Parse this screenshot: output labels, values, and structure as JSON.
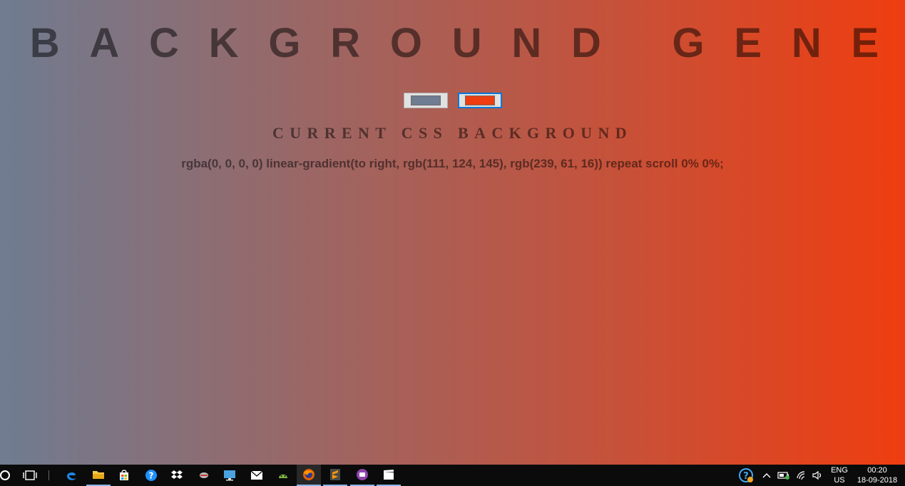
{
  "page": {
    "title": "BACKGROUND GENERATOR",
    "subtitle": "CURRENT CSS BACKGROUND",
    "css_output": "rgba(0, 0, 0, 0) linear-gradient(to right, rgb(111, 124, 145), rgb(239, 61, 16)) repeat scroll 0% 0%;",
    "color1": "#6f7c91",
    "color2": "#ef3d10"
  },
  "taskbar": {
    "icons": [
      {
        "name": "cortana-icon"
      },
      {
        "name": "task-view-icon"
      },
      {
        "name": "edge-icon"
      },
      {
        "name": "file-explorer-icon"
      },
      {
        "name": "store-icon"
      },
      {
        "name": "help-icon"
      },
      {
        "name": "dropbox-icon"
      },
      {
        "name": "app-icon"
      },
      {
        "name": "remote-desktop-icon"
      },
      {
        "name": "mail-icon"
      },
      {
        "name": "android-studio-icon"
      },
      {
        "name": "firefox-icon"
      },
      {
        "name": "sublime-text-icon"
      },
      {
        "name": "app-purple-icon"
      },
      {
        "name": "clapperboard-icon"
      }
    ],
    "language_top": "ENG",
    "language_bottom": "US",
    "time": "00:20",
    "date": "18-09-2018"
  }
}
